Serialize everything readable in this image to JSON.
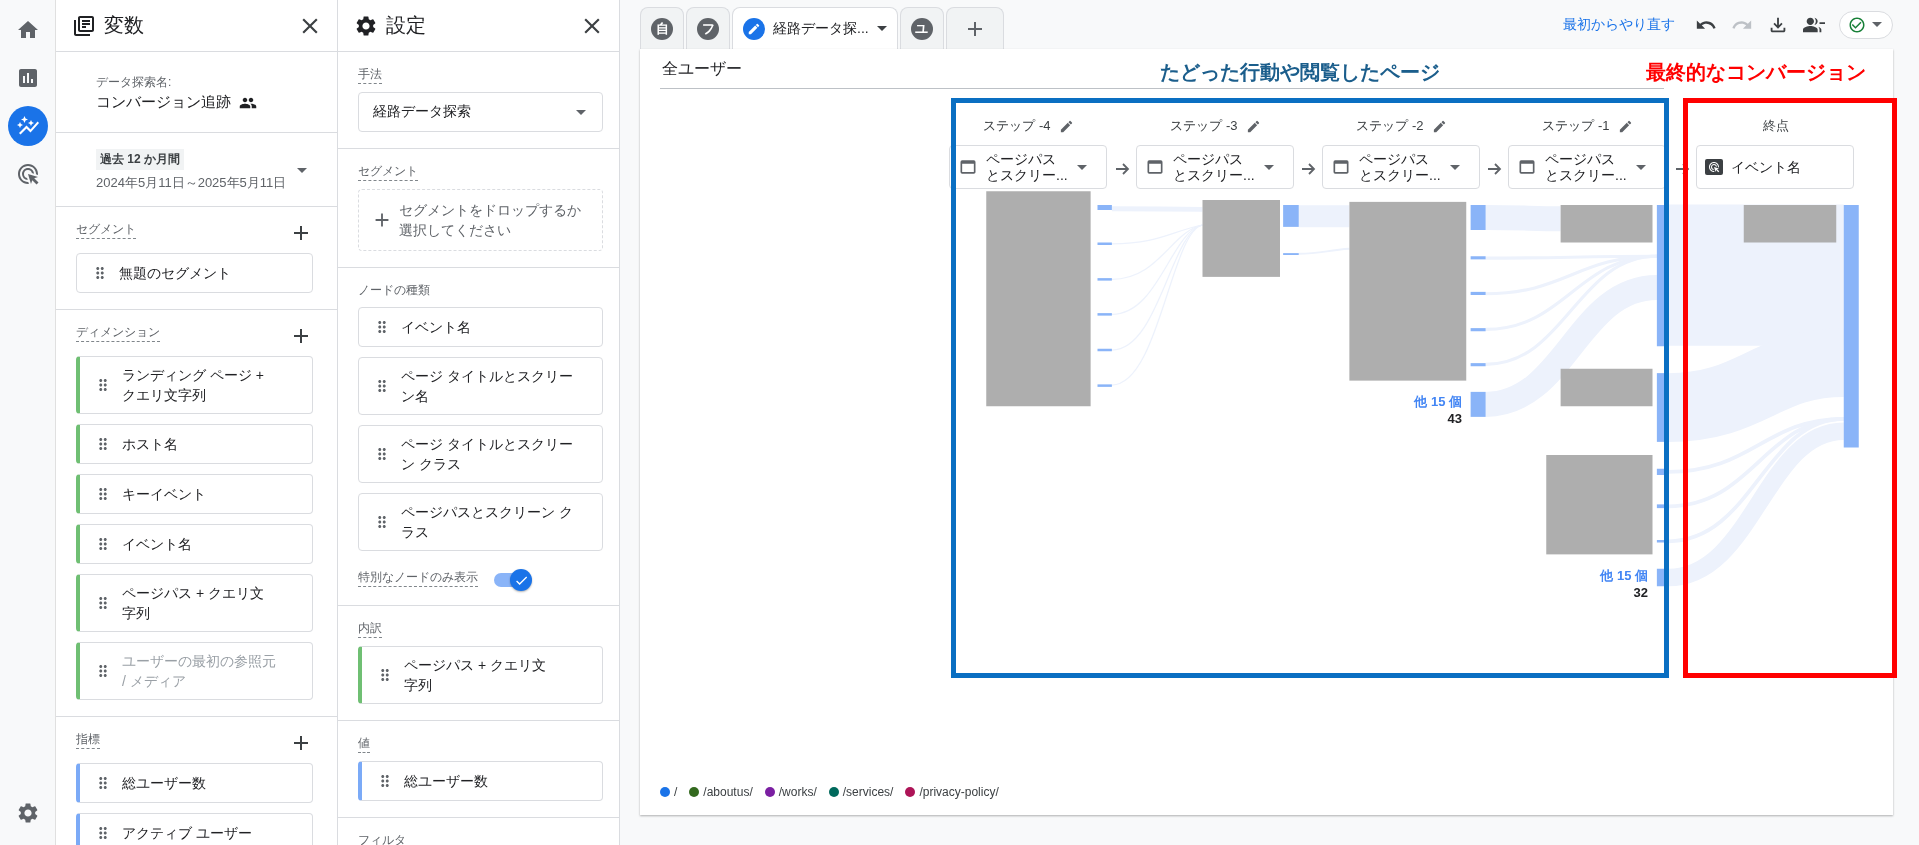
{
  "nav_rail": {
    "items": [
      {
        "kind": "home",
        "selected": false
      },
      {
        "kind": "reports",
        "selected": false
      },
      {
        "kind": "explore",
        "selected": true
      },
      {
        "kind": "advertising",
        "selected": false
      }
    ]
  },
  "variables_panel": {
    "title": "変数",
    "name_label": "データ探索名:",
    "name": "コンバージョン追跡",
    "date_range": {
      "label": "過去 12 か月間",
      "value": "2024年5月11日～2025年5月11日"
    },
    "segments": {
      "title": "セグメント",
      "items": [
        {
          "label": "無題のセグメント",
          "disabled": false
        }
      ]
    },
    "dimensions": {
      "title": "ディメンション",
      "items": [
        {
          "label": "ランディング ページ + クエリ文字列",
          "disabled": false
        },
        {
          "label": "ホスト名",
          "disabled": false
        },
        {
          "label": "キーイベント",
          "disabled": false
        },
        {
          "label": "イベント名",
          "disabled": false
        },
        {
          "label": "ページパス + クエリ文字列",
          "disabled": false
        },
        {
          "label": "ユーザーの最初の参照元 / メディア",
          "disabled": true
        }
      ]
    },
    "metrics": {
      "title": "指標",
      "items": [
        {
          "label": "総ユーザー数",
          "disabled": false
        },
        {
          "label": "アクティブ ユーザー",
          "disabled": false
        }
      ]
    }
  },
  "settings_panel": {
    "title": "設定",
    "technique": {
      "label": "手法",
      "value": "経路データ探索"
    },
    "segment_drop": {
      "label": "セグメント",
      "placeholder": "セグメントをドロップするか選択してください"
    },
    "node_types": {
      "label": "ノードの種類",
      "items": [
        "イベント名",
        "ページ タイトルとスクリーン名",
        "ページ タイトルとスクリーン クラス",
        "ページパスとスクリーン クラス"
      ]
    },
    "special_nodes": {
      "label": "特別なノードのみ表示",
      "on": true
    },
    "breakdown": {
      "label": "内訳",
      "item": "ページパス + クエリ文字列"
    },
    "value": {
      "label": "値",
      "item": "総ユーザー数"
    },
    "filter": {
      "label": "フィルタ"
    }
  },
  "tabs": [
    {
      "kind": "letter",
      "label": "自",
      "selected": false
    },
    {
      "kind": "letter",
      "label": "フ",
      "selected": false
    },
    {
      "kind": "exploration",
      "label": "経路データ探...",
      "selected": true
    },
    {
      "kind": "letter",
      "label": "ユ",
      "selected": false
    }
  ],
  "toolbar": {
    "reset_link": "最初からやり直す",
    "undo": {
      "disabled": false
    },
    "redo": {
      "disabled": true
    }
  },
  "canvas": {
    "segment_label": "全ユーザー",
    "paths_annotation": "たどった行動や閲覧したページ",
    "conversion_annotation": "最終的なコンバージョン",
    "steps": [
      {
        "kind": "page",
        "label": "ステップ -4",
        "node": "ページパスとスクリー..."
      },
      {
        "kind": "page",
        "label": "ステップ -3",
        "node": "ページパスとスクリー..."
      },
      {
        "kind": "page",
        "label": "ステップ -2",
        "node": "ページパスとスクリー..."
      },
      {
        "kind": "page",
        "label": "ステップ -1",
        "node": "ページパスとスクリー..."
      },
      {
        "kind": "end",
        "label": "終点",
        "node": "イベント名"
      }
    ],
    "others": [
      {
        "label": "他 15 個",
        "count": "43"
      },
      {
        "label": "他 15 個",
        "count": "32"
      }
    ],
    "legend": [
      {
        "label": "/",
        "color": "#1a73e8"
      },
      {
        "label": "/aboutus/",
        "color": "#33691e"
      },
      {
        "label": "/works/",
        "color": "#7b1fa2"
      },
      {
        "label": "/services/",
        "color": "#00695c"
      },
      {
        "label": "/privacy-policy/",
        "color": "#ad1457"
      }
    ]
  }
}
